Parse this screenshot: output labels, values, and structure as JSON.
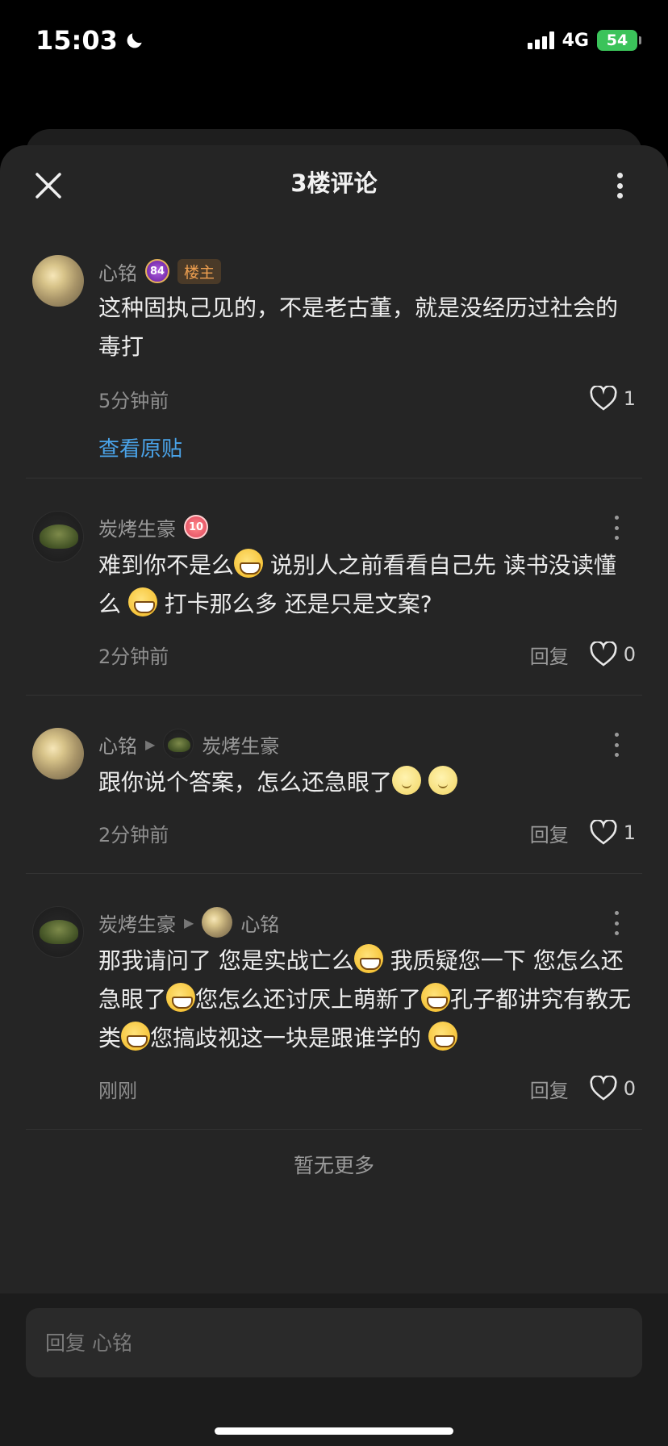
{
  "status": {
    "time": "15:03",
    "network": "4G",
    "battery": "54"
  },
  "header": {
    "title": "3楼评论"
  },
  "comments": [
    {
      "user": "心铭",
      "level": "84",
      "badge": "楼主",
      "text": "这种固执己见的，不是老古董，就是没经历过社会的毒打",
      "time": "5分钟前",
      "likes": "1",
      "view_post": "查看原贴"
    },
    {
      "user": "炭烤生豪",
      "level": "10",
      "text_parts": [
        "难到你不是么",
        "说别人之前看看自己先  读书没读懂么 ",
        " 打卡那么多 还是只是文案?"
      ],
      "time": "2分钟前",
      "reply": "回复",
      "likes": "0"
    },
    {
      "user": "心铭",
      "reply_to": "炭烤生豪",
      "text": "跟你说个答案，怎么还急眼了",
      "time": "2分钟前",
      "reply": "回复",
      "likes": "1"
    },
    {
      "user": "炭烤生豪",
      "reply_to": "心铭",
      "text_parts": [
        "那我请问了 您是实战亡么",
        " 我质疑您一下 您怎么还急眼了",
        "您怎么还讨厌上萌新了",
        "孔子都讲究有教无类",
        "您搞歧视这一块是跟谁学的"
      ],
      "time": "刚刚",
      "reply": "回复",
      "likes": "0"
    }
  ],
  "footer": {
    "no_more": "暂无更多",
    "input_placeholder": "回复 心铭"
  }
}
